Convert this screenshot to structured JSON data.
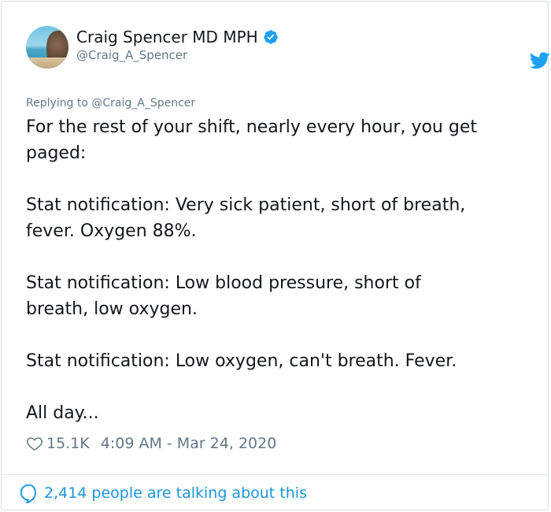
{
  "author": {
    "name": "Craig Spencer MD MPH",
    "handle": "@Craig_A_Spencer"
  },
  "reply_context": "Replying to @Craig_A_Spencer",
  "tweet_text": "For the rest of your shift, nearly every hour, you get\npaged:\n\nStat notification: Very sick patient, short of breath,\nfever. Oxygen 88%.\n\nStat notification: Low blood pressure, short of\nbreath, low oxygen.\n\nStat notification: Low oxygen, can't breath. Fever.\n\nAll day...",
  "metrics": {
    "likes": "15.1K",
    "timestamp": "4:09 AM - Mar 24, 2020"
  },
  "footer": {
    "conversation_text": "2,414 people are talking about this"
  },
  "colors": {
    "accent": "#1da1f2",
    "link": "#1b95e0",
    "secondary_text": "#657786"
  },
  "icons": {
    "verified": "verified-badge-icon",
    "brand": "twitter-bird-icon",
    "like": "heart-icon",
    "conversation": "speech-bubble-icon"
  }
}
